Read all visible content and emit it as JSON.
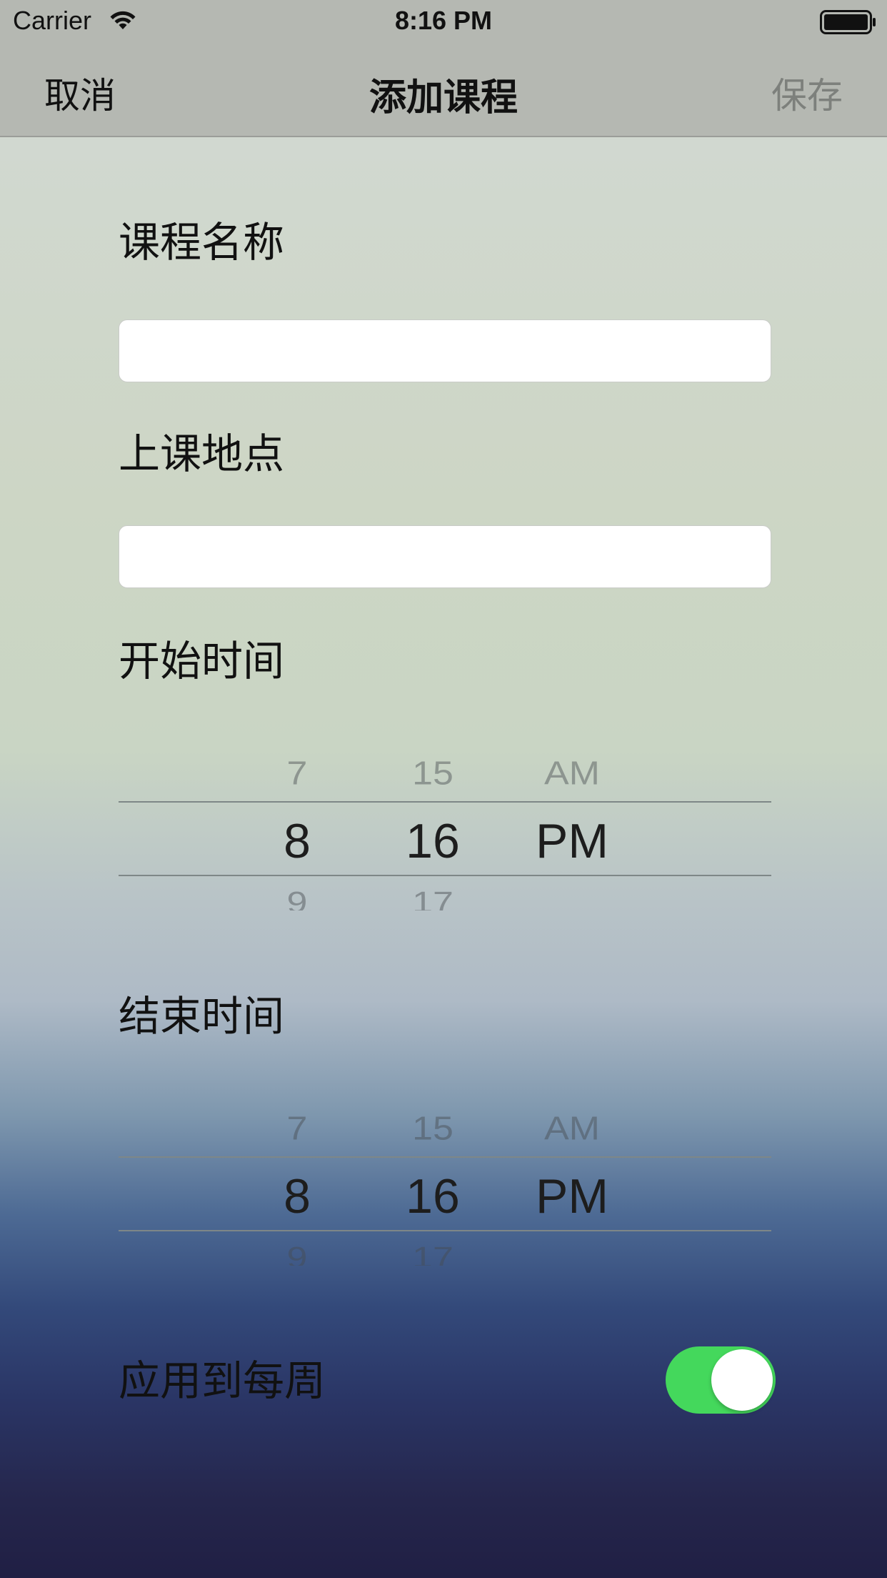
{
  "status_bar": {
    "carrier": "Carrier",
    "time": "8:16 PM",
    "icons": [
      "wifi-icon",
      "battery-icon"
    ]
  },
  "nav": {
    "cancel_label": "取消",
    "title": "添加课程",
    "save_label": "保存"
  },
  "form": {
    "course_name": {
      "label": "课程名称",
      "value": "",
      "placeholder": ""
    },
    "location": {
      "label": "上课地点",
      "value": "",
      "placeholder": ""
    },
    "start_time": {
      "label": "开始时间",
      "hour_prev": "7",
      "hour": "8",
      "hour_next": "9",
      "minute_prev": "15",
      "minute": "16",
      "minute_next": "17",
      "period_prev": "AM",
      "period": "PM"
    },
    "end_time": {
      "label": "结束时间",
      "hour_prev": "7",
      "hour": "8",
      "hour_next": "9",
      "minute_prev": "15",
      "minute": "16",
      "minute_next": "17",
      "period_prev": "AM",
      "period": "PM"
    },
    "repeat_weekly": {
      "label": "应用到每周",
      "enabled": true
    }
  },
  "colors": {
    "toggle_on": "#44d85c",
    "save_disabled": "#7d807c",
    "nav_background": "#b5b8b2"
  }
}
